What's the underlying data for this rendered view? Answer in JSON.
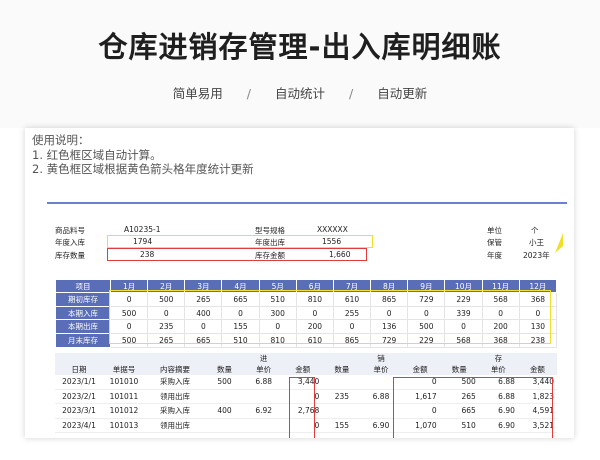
{
  "title": "仓库进销存管理-出入库明细账",
  "subtitles": [
    "简单易用",
    "/",
    "自动统计",
    "/",
    "自动更新"
  ],
  "instructions": [
    "使用说明：",
    "1. 红色框区域自动计算。",
    "2. 黄色框区域根据黄色箭头格年度统计更新"
  ],
  "info": {
    "item_no_label": "商品料号",
    "item_no": "A10235-1",
    "model_label": "型号规格",
    "model": "XXXXXX",
    "unit_label": "单位",
    "unit": "个",
    "year_in_label": "年度入库",
    "year_in": "1794",
    "year_out_label": "年度出库",
    "year_out": "1556",
    "keeper_label": "保管",
    "keeper": "小王",
    "stock_qty_label": "库存数量",
    "stock_qty": "238",
    "stock_amt_label": "库存金额",
    "stock_amt": "1,660",
    "year_label": "年度",
    "year": "2023年"
  },
  "monthly": {
    "header": [
      "项目",
      "1月",
      "2月",
      "3月",
      "4月",
      "5月",
      "6月",
      "7月",
      "8月",
      "9月",
      "10月",
      "11月",
      "12月"
    ],
    "rows": [
      [
        "期初库存",
        "0",
        "500",
        "265",
        "665",
        "510",
        "810",
        "610",
        "865",
        "729",
        "229",
        "568",
        "368"
      ],
      [
        "本期入库",
        "500",
        "0",
        "400",
        "0",
        "300",
        "0",
        "255",
        "0",
        "0",
        "339",
        "0",
        "0"
      ],
      [
        "本期出库",
        "0",
        "235",
        "0",
        "155",
        "0",
        "200",
        "0",
        "136",
        "500",
        "0",
        "200",
        "130"
      ],
      [
        "月末库存",
        "500",
        "265",
        "665",
        "510",
        "810",
        "610",
        "865",
        "729",
        "229",
        "568",
        "368",
        "238"
      ]
    ]
  },
  "detail": {
    "group_in": "进",
    "group_sales": "销",
    "group_stock": "存",
    "cols": [
      "日期",
      "单据号",
      "内容摘要",
      "数量",
      "单价",
      "金额",
      "数量",
      "单价",
      "金额",
      "数量",
      "单价",
      "金额"
    ],
    "rows": [
      [
        "2023/1/1",
        "101010",
        "采购入库",
        "500",
        "6.88",
        "3,440",
        "",
        "",
        "0",
        "500",
        "6.88",
        "3,440"
      ],
      [
        "2023/2/1",
        "101011",
        "领用出库",
        "",
        "",
        "0",
        "235",
        "6.88",
        "1,617",
        "265",
        "6.88",
        "1,823"
      ],
      [
        "2023/3/1",
        "101012",
        "采购入库",
        "400",
        "6.92",
        "2,768",
        "",
        "",
        "0",
        "665",
        "6.90",
        "4,591"
      ],
      [
        "2023/4/1",
        "101013",
        "领用出库",
        "",
        "",
        "0",
        "155",
        "6.90",
        "1,070",
        "510",
        "6.90",
        "3,521"
      ]
    ]
  }
}
